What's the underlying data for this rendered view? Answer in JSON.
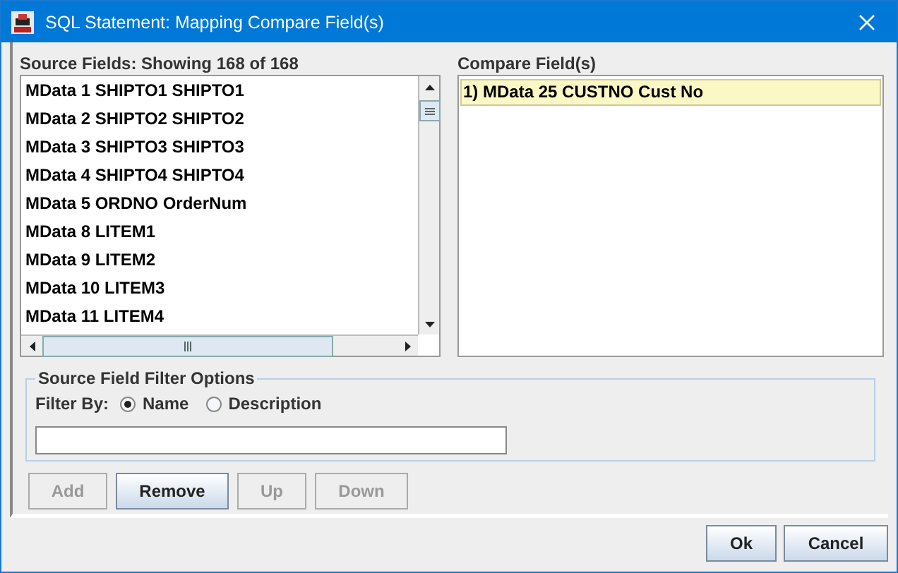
{
  "window": {
    "title": "SQL Statement: Mapping Compare Field(s)"
  },
  "source": {
    "label": "Source Fields: Showing 168 of 168",
    "items": [
      {
        "text": "MData 1 SHIPTO1 SHIPTO1",
        "selected": false
      },
      {
        "text": "MData 2 SHIPTO2 SHIPTO2",
        "selected": false
      },
      {
        "text": "MData 3 SHIPTO3 SHIPTO3",
        "selected": false
      },
      {
        "text": "MData 4 SHIPTO4 SHIPTO4",
        "selected": false
      },
      {
        "text": "MData 5 ORDNO OrderNum",
        "selected": false
      },
      {
        "text": "MData 8 LITEM1",
        "selected": false
      },
      {
        "text": "MData 9 LITEM2",
        "selected": false
      },
      {
        "text": "MData 10 LITEM3",
        "selected": false
      },
      {
        "text": "MData 11 LITEM4",
        "selected": false
      }
    ]
  },
  "compare": {
    "label": "Compare Field(s)",
    "items": [
      {
        "text": "1) MData 25 CUSTNO Cust No",
        "selected": true
      }
    ]
  },
  "filter": {
    "title": "Source Field Filter Options",
    "label": "Filter By:",
    "options": [
      {
        "label": "Name",
        "selected": true
      },
      {
        "label": "Description",
        "selected": false
      }
    ]
  },
  "actions": [
    {
      "label": "Add",
      "disabled": true
    },
    {
      "label": "Remove",
      "disabled": false
    },
    {
      "label": "Up",
      "disabled": true
    },
    {
      "label": "Down",
      "disabled": true
    }
  ],
  "buttons": [
    {
      "label": "Ok"
    },
    {
      "label": "Cancel"
    }
  ]
}
